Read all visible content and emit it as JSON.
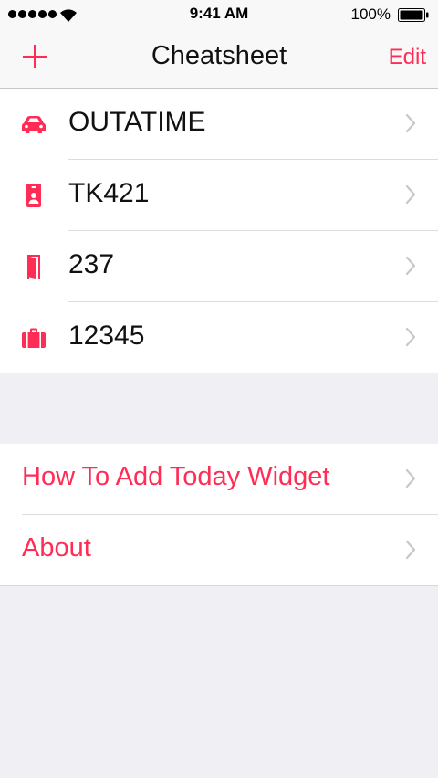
{
  "status_bar": {
    "time": "9:41 AM",
    "battery": "100%"
  },
  "nav": {
    "title": "Cheatsheet",
    "edit_label": "Edit"
  },
  "cheats": [
    {
      "icon": "car-icon",
      "label": "OUTATIME"
    },
    {
      "icon": "id-badge-icon",
      "label": "TK421"
    },
    {
      "icon": "door-icon",
      "label": "237"
    },
    {
      "icon": "briefcase-icon",
      "label": "12345"
    }
  ],
  "links": [
    {
      "label": "How To Add Today Widget"
    },
    {
      "label": "About"
    }
  ],
  "colors": {
    "accent": "#ff2d55",
    "background": "#efeff4",
    "separator": "#dcdce0"
  }
}
